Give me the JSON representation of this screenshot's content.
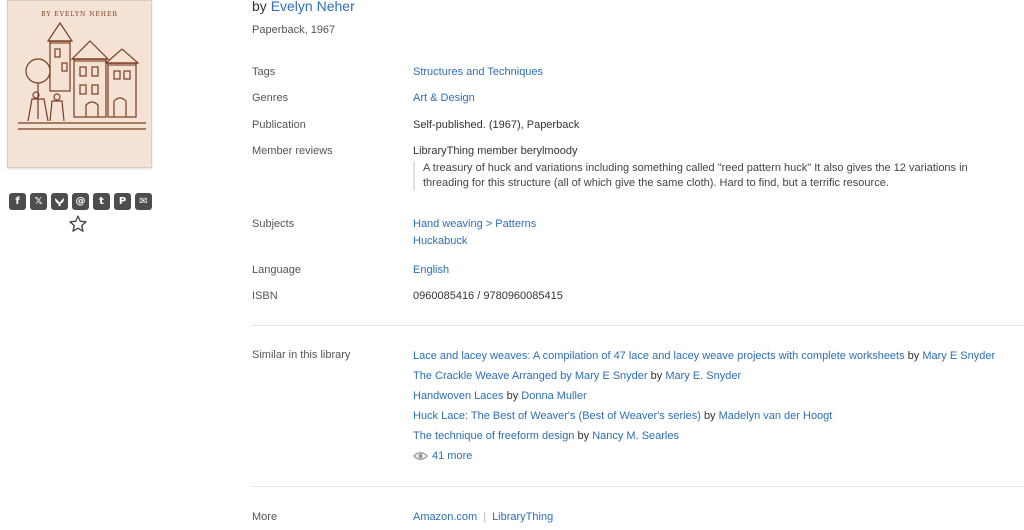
{
  "cover": {
    "text": "BY EVELYN NEHER"
  },
  "book": {
    "by_prefix": "by",
    "author": "Evelyn Neher",
    "edition": "Paperback, 1967"
  },
  "details": {
    "tags_label": "Tags",
    "tags_value": "Structures and Techniques",
    "genres_label": "Genres",
    "genres_value": "Art & Design",
    "publication_label": "Publication",
    "publication_value": "Self-published. (1967), Paperback",
    "reviews_label": "Member reviews",
    "review_author": "LibraryThing member berylmoody",
    "review_text": "A treasury of huck and variations including something called \"reed pattern huck\" It also gives the 12 variations in threading for this structure (all of which give the same cloth). Hard to find, but a terrific resource.",
    "subjects_label": "Subjects",
    "subject_1a": "Hand weaving",
    "subject_sep": ">",
    "subject_1b": "Patterns",
    "subject_2": "Huckabuck",
    "language_label": "Language",
    "language_value": "English",
    "isbn_label": "ISBN",
    "isbn_value": "0960085416 / 9780960085415"
  },
  "similar": {
    "label": "Similar in this library",
    "items": [
      {
        "title": "Lace and lacey weaves: A compilation of 47 lace and lacey weave projects with complete worksheets",
        "by": "by",
        "author": "Mary E Snyder"
      },
      {
        "title": "The Crackle Weave Arranged by Mary E Snyder",
        "by": "by",
        "author": "Mary E. Snyder"
      },
      {
        "title": "Handwoven Laces",
        "by": "by",
        "author": "Donna Muller"
      },
      {
        "title": "Huck Lace: The Best of Weaver's (Best of Weaver's series)",
        "by": "by",
        "author": "Madelyn van der Hoogt"
      },
      {
        "title": "The technique of freeform design",
        "by": "by",
        "author": "Nancy M. Searles"
      }
    ],
    "more": "41 more"
  },
  "more": {
    "label": "More",
    "link_1": "Amazon.com",
    "link_2": "LibraryThing"
  },
  "share_icons": [
    {
      "name": "facebook-icon",
      "glyph": "f"
    },
    {
      "name": "x-icon",
      "glyph": "𝕏"
    },
    {
      "name": "bluesky-icon",
      "glyph": "🦋"
    },
    {
      "name": "threads-icon",
      "glyph": "@"
    },
    {
      "name": "tumblr-icon",
      "glyph": "t"
    },
    {
      "name": "pinterest-icon",
      "glyph": "P"
    },
    {
      "name": "email-icon",
      "glyph": "✉"
    }
  ],
  "colors": {
    "link": "#2d6fb6",
    "cover_bg": "#f4e3d4",
    "cover_ink": "#7b3b1f"
  }
}
